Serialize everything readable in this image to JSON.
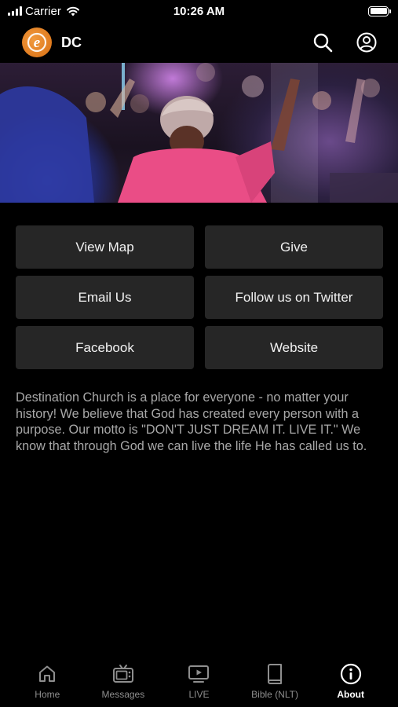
{
  "status_bar": {
    "carrier": "Carrier",
    "time": "10:26 AM"
  },
  "nav": {
    "title": "DC",
    "logo_letter": "e",
    "logo_color": "#e07a1f",
    "icons": [
      "search-icon",
      "account-icon"
    ]
  },
  "hero": {
    "image": "worship-crowd-photo"
  },
  "buttons": [
    {
      "label": "View Map"
    },
    {
      "label": "Give"
    },
    {
      "label": "Email Us"
    },
    {
      "label": "Follow us on Twitter"
    },
    {
      "label": "Facebook"
    },
    {
      "label": "Website"
    }
  ],
  "description": "Destination Church is a place for everyone - no matter your history! We believe that God has created every person with a purpose. Our motto is \"DON'T JUST DREAM IT. LIVE IT.\" We know that through God we can live the life He has called us to.",
  "tabs": [
    {
      "label": "Home",
      "icon": "home-icon",
      "active": false
    },
    {
      "label": "Messages",
      "icon": "tv-icon",
      "active": false
    },
    {
      "label": "LIVE",
      "icon": "play-screen-icon",
      "active": false
    },
    {
      "label": "Bible (NLT)",
      "icon": "book-icon",
      "active": false
    },
    {
      "label": "About",
      "icon": "info-icon",
      "active": true
    }
  ],
  "colors": {
    "background": "#000000",
    "button_bg": "#262626",
    "inactive_tab": "#8e8e8e",
    "active_tab": "#ffffff"
  }
}
